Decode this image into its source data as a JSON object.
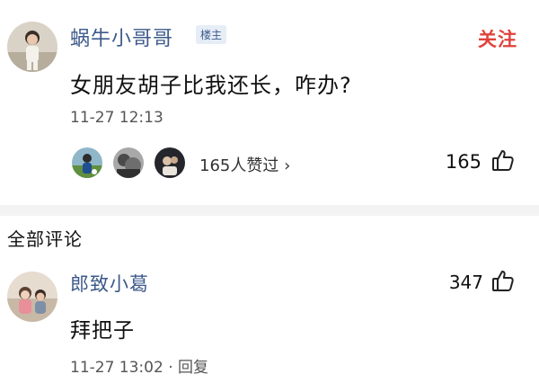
{
  "post": {
    "username": "蜗牛小哥哥",
    "badge": "楼主",
    "follow_label": "关注",
    "text": "女朋友胡子比我还长，咋办?",
    "time": "11-27 12:13",
    "likes_label": "165人赞过 ›",
    "like_count": "165",
    "avatar_icon": "user-avatar-photo",
    "thumb_icon": "thumb-up-icon"
  },
  "section": {
    "title": "全部评论"
  },
  "comment": {
    "username": "郎致小葛",
    "like_count": "347",
    "text": "拜把子",
    "meta": "11-27 13:02 · 回复",
    "avatar_icon": "user-avatar-photo",
    "thumb_icon": "thumb-up-icon"
  },
  "colors": {
    "username": "#3d5a8a",
    "follow": "#e0423b",
    "divider": "#f3f3f3"
  }
}
